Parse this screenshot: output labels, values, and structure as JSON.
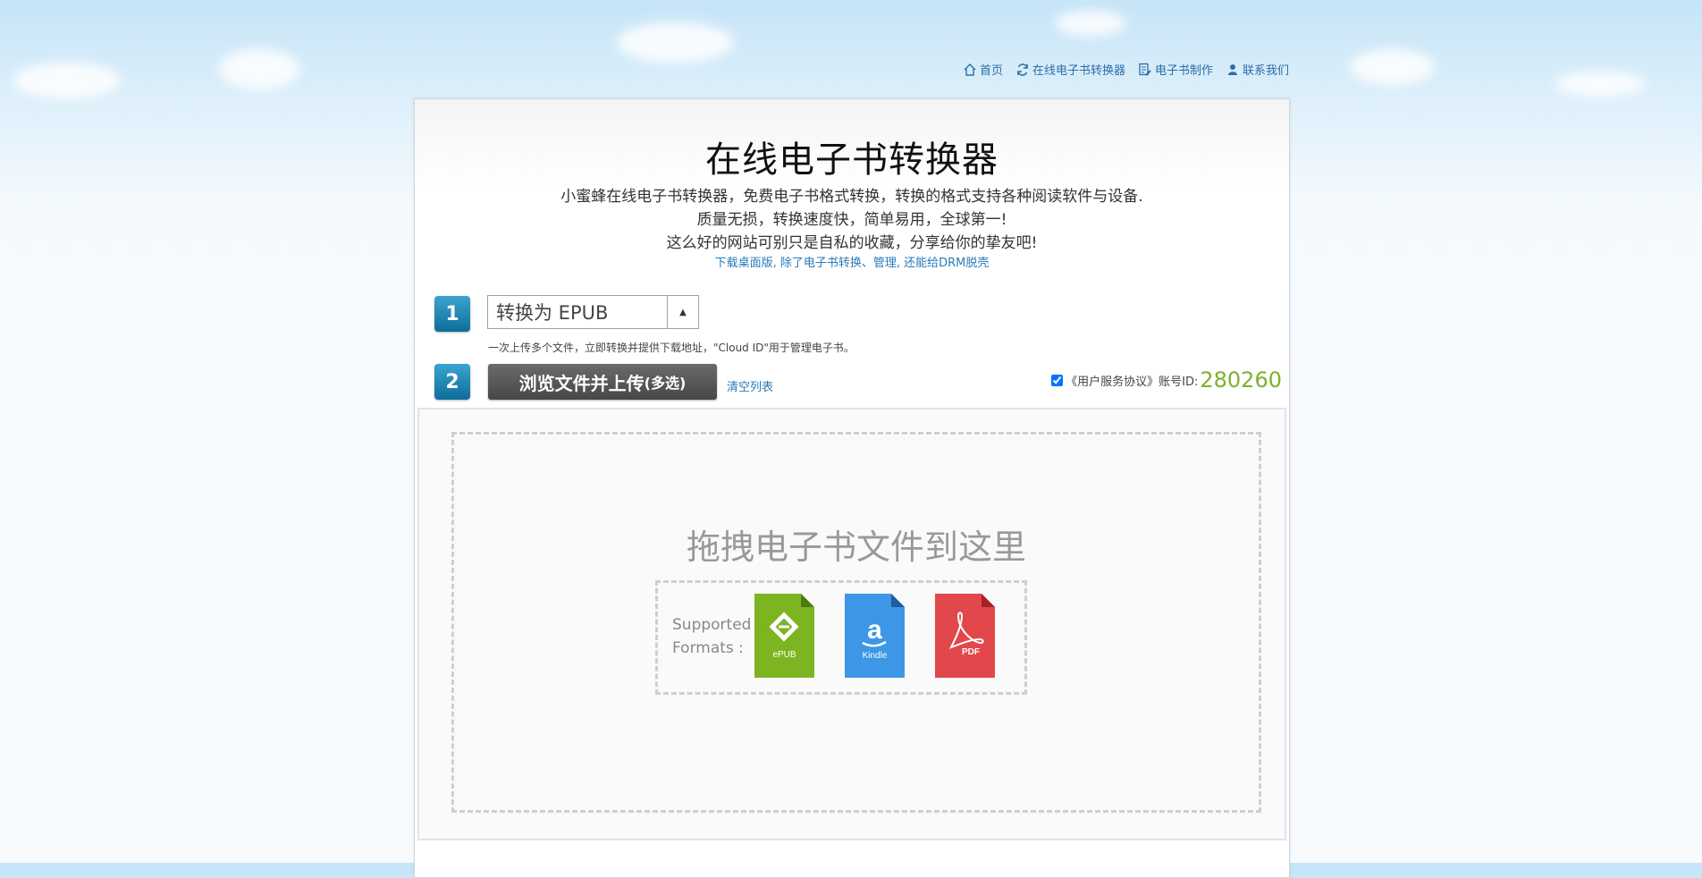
{
  "nav": {
    "home": "首页",
    "converter": "在线电子书转换器",
    "maker": "电子书制作",
    "contact": "联系我们"
  },
  "header": {
    "title": "在线电子书转换器",
    "intro_line1": "小蜜蜂在线电子书转换器，免费电子书格式转换，转换的格式支持各种阅读软件与设备.",
    "intro_line2": "质量无损，转换速度快，简单易用，全球第一!",
    "intro_line3": "这么好的网站可别只是自私的收藏，分享给你的挚友吧!",
    "download_link": "下载桌面版, 除了电子书转换、管理, 还能给DRM脱壳"
  },
  "step1": {
    "number": "1",
    "selected_format": "转换为 EPUB",
    "hint": "一次上传多个文件，立即转换并提供下载地址，\"Cloud ID\"用于管理电子书。"
  },
  "step2": {
    "number": "2",
    "upload_label": "浏览文件并上传",
    "upload_suffix": "(多选)",
    "clear_label": "清空列表",
    "agreement": "《用户服务协议》",
    "account_label": "账号ID:",
    "account_id": "280260"
  },
  "dropzone": {
    "text": "拖拽电子书文件到这里",
    "formats_label_1": "Supported",
    "formats_label_2": "Formats :",
    "epub_label": "ePUB",
    "kindle_label": "Kindle",
    "pdf_label": "PDF"
  },
  "colors": {
    "link": "#2a7ab8",
    "account_id": "#7fb02c",
    "epub": "#7db421",
    "kindle": "#3d97e6",
    "pdf": "#e2474b"
  }
}
